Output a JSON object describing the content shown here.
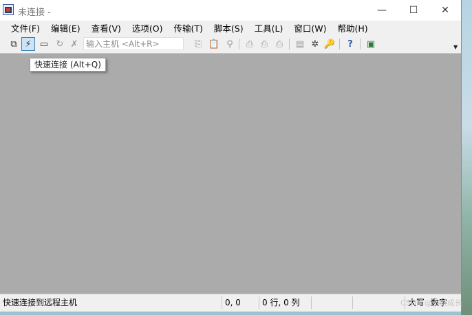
{
  "window": {
    "title": "未连接 -",
    "controls": {
      "minimize": "—",
      "maximize": "☐",
      "close": "✕"
    }
  },
  "menu": [
    "文件(F)",
    "编辑(E)",
    "查看(V)",
    "选项(O)",
    "传输(T)",
    "脚本(S)",
    "工具(L)",
    "窗口(W)",
    "帮助(H)"
  ],
  "toolbar": {
    "host_placeholder": "输入主机 <Alt+R>",
    "tooltip": "快速连接 (Alt+Q)",
    "icons": {
      "connect": "⧉",
      "quick_connect": "⚡",
      "connect_tab": "▭",
      "reconnect": "↻",
      "disconnect": "✗",
      "copy": "⎘",
      "paste": "📋",
      "find": "⚲",
      "print": "⎙",
      "print_setup": "⎙",
      "print_sel": "⎙",
      "session_options": "▤",
      "global_options": "✲",
      "keymap": "🔑",
      "help": "?",
      "sftp": "▣"
    }
  },
  "status": {
    "message": "快速连接到远程主机",
    "position": "0, 0",
    "rowcol": "0 行, 0 列",
    "caps": "大写",
    "num": "数字"
  },
  "watermark": "CSDN @小新成长"
}
